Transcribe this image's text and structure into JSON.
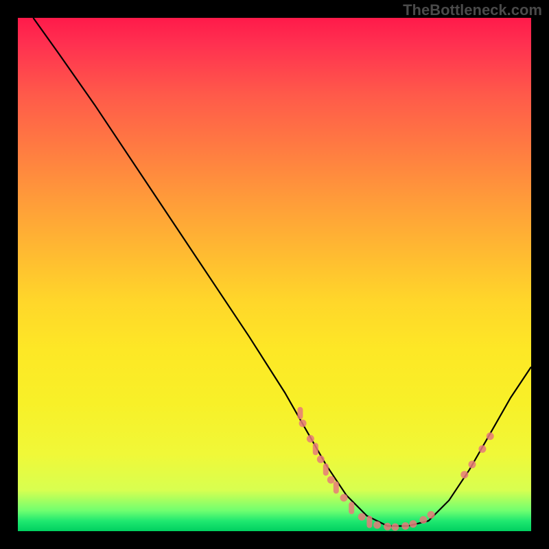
{
  "watermark": "TheBottleneck.com",
  "chart_data": {
    "type": "line",
    "title": "",
    "xlabel": "",
    "ylabel": "",
    "xlim": [
      0,
      100
    ],
    "ylim": [
      0,
      100
    ],
    "curve": [
      {
        "x": 3,
        "y": 100
      },
      {
        "x": 8,
        "y": 93
      },
      {
        "x": 15,
        "y": 83
      },
      {
        "x": 25,
        "y": 68
      },
      {
        "x": 35,
        "y": 53
      },
      {
        "x": 45,
        "y": 38
      },
      {
        "x": 52,
        "y": 27
      },
      {
        "x": 56,
        "y": 20
      },
      {
        "x": 60,
        "y": 13
      },
      {
        "x": 64,
        "y": 7
      },
      {
        "x": 68,
        "y": 3
      },
      {
        "x": 72,
        "y": 1
      },
      {
        "x": 76,
        "y": 1
      },
      {
        "x": 80,
        "y": 2
      },
      {
        "x": 84,
        "y": 6
      },
      {
        "x": 88,
        "y": 12
      },
      {
        "x": 92,
        "y": 19
      },
      {
        "x": 96,
        "y": 26
      },
      {
        "x": 100,
        "y": 32
      }
    ],
    "markers": [
      {
        "x": 55,
        "y": 23,
        "kind": "bar"
      },
      {
        "x": 55.5,
        "y": 21,
        "kind": "dot"
      },
      {
        "x": 57,
        "y": 18,
        "kind": "dot"
      },
      {
        "x": 58,
        "y": 16,
        "kind": "bar"
      },
      {
        "x": 59,
        "y": 14,
        "kind": "dot"
      },
      {
        "x": 60,
        "y": 12,
        "kind": "bar"
      },
      {
        "x": 61,
        "y": 10,
        "kind": "dot"
      },
      {
        "x": 62,
        "y": 8.5,
        "kind": "bar"
      },
      {
        "x": 63.5,
        "y": 6.5,
        "kind": "dot"
      },
      {
        "x": 65,
        "y": 4.5,
        "kind": "bar"
      },
      {
        "x": 67,
        "y": 2.8,
        "kind": "dot"
      },
      {
        "x": 68.5,
        "y": 1.8,
        "kind": "bar"
      },
      {
        "x": 70,
        "y": 1.2,
        "kind": "dot"
      },
      {
        "x": 72,
        "y": 0.9,
        "kind": "dot"
      },
      {
        "x": 73.5,
        "y": 0.8,
        "kind": "dot"
      },
      {
        "x": 75.5,
        "y": 1.0,
        "kind": "dot"
      },
      {
        "x": 77,
        "y": 1.4,
        "kind": "dot"
      },
      {
        "x": 79,
        "y": 2.2,
        "kind": "dot"
      },
      {
        "x": 80.5,
        "y": 3.2,
        "kind": "dot"
      },
      {
        "x": 87,
        "y": 11,
        "kind": "dot"
      },
      {
        "x": 88.5,
        "y": 13,
        "kind": "dot"
      },
      {
        "x": 90.5,
        "y": 16,
        "kind": "dot"
      },
      {
        "x": 92,
        "y": 18.5,
        "kind": "dot"
      }
    ],
    "colors": {
      "curve": "#000000",
      "markers": "#e67a7a",
      "gradient_top": "#ff1a4a",
      "gradient_bottom": "#00d060"
    }
  }
}
